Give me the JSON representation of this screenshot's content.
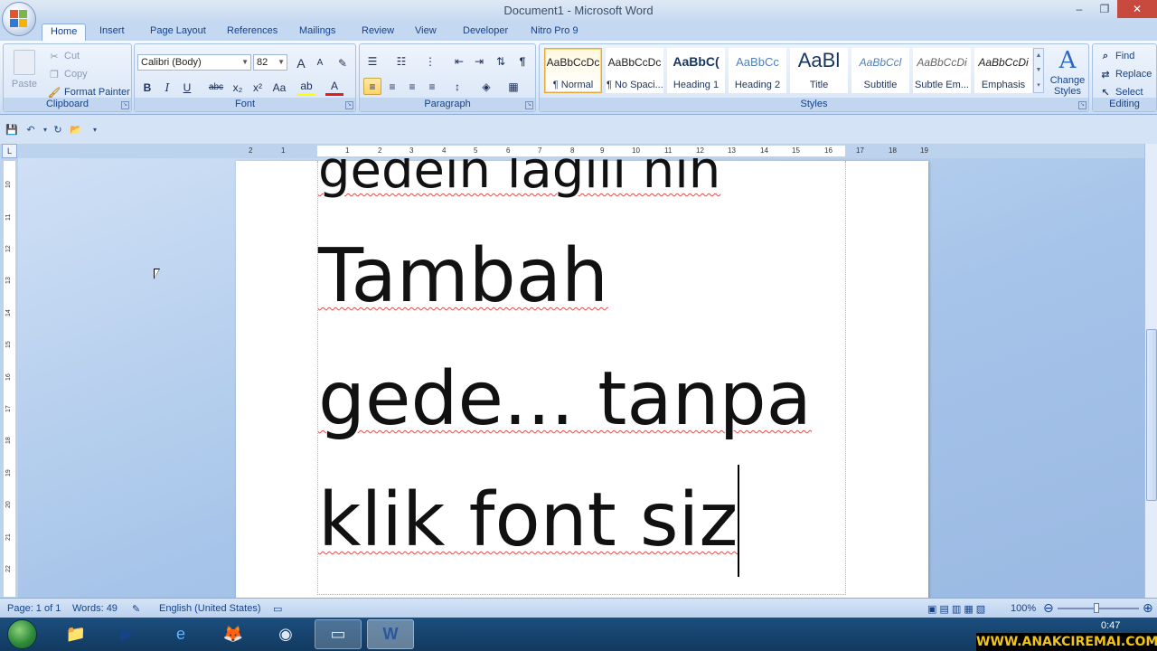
{
  "window": {
    "title": "Document1 - Microsoft Word",
    "minimize": "–",
    "restore": "❐",
    "close": "✕"
  },
  "tabs": [
    "Home",
    "Insert",
    "Page Layout",
    "References",
    "Mailings",
    "Review",
    "View",
    "Developer",
    "Nitro Pro 9"
  ],
  "clipboard": {
    "paste": "Paste",
    "cut": "Cut",
    "copy": "Copy",
    "format_painter": "Format Painter",
    "label": "Clipboard"
  },
  "font": {
    "name": "Calibri (Body)",
    "size": "82",
    "label": "Font",
    "grow": "A",
    "shrink": "A",
    "clear": "✎",
    "bold": "B",
    "italic": "I",
    "underline": "U",
    "strike": "abc",
    "subscript": "x₂",
    "superscript": "x²",
    "case": "Aa",
    "highlight": "ab",
    "color": "A"
  },
  "paragraph": {
    "label": "Paragraph",
    "bullets": "☰",
    "numbering": "☷",
    "multilevel": "⋮",
    "decrease_indent": "⇤",
    "increase_indent": "⇥",
    "sort": "⇅",
    "show_marks": "¶",
    "align_left": "≡",
    "align_center": "≡",
    "align_right": "≡",
    "justify": "≡",
    "line_spacing": "↕",
    "shading": "◈",
    "borders": "▦"
  },
  "styles": {
    "label": "Styles",
    "items": [
      {
        "preview": "AaBbCcDc",
        "name": "¶ Normal"
      },
      {
        "preview": "AaBbCcDc",
        "name": "¶ No Spaci..."
      },
      {
        "preview": "AaBbC(",
        "name": "Heading 1"
      },
      {
        "preview": "AaBbCc",
        "name": "Heading 2"
      },
      {
        "preview": "AaBl",
        "name": "Title"
      },
      {
        "preview": "AaBbCcl",
        "name": "Subtitle"
      },
      {
        "preview": "AaBbCcDi",
        "name": "Subtle Em..."
      },
      {
        "preview": "AaBbCcDi",
        "name": "Emphasis"
      }
    ],
    "change_styles": "Change Styles",
    "change_icon": "A"
  },
  "editing": {
    "label": "Editing",
    "find": "Find",
    "replace": "Replace",
    "select": "Select"
  },
  "ruler": {
    "corner": "L",
    "hticks": [
      "2",
      "1",
      "1",
      "2",
      "3",
      "4",
      "5",
      "6",
      "7",
      "8",
      "9",
      "10",
      "11",
      "12",
      "13",
      "14",
      "15",
      "16",
      "17",
      "18",
      "19"
    ],
    "vticks": [
      "10",
      "11",
      "12",
      "13",
      "14",
      "15",
      "16",
      "17",
      "18",
      "19",
      "20",
      "21",
      "22"
    ]
  },
  "document": {
    "lines": [
      "gedein lagiii nih",
      "Tambah",
      "gede... tanpa",
      "klik font siz"
    ]
  },
  "status": {
    "page": "Page: 1 of 1",
    "words": "Words: 49",
    "language": "English (United States)",
    "zoom": "100%"
  },
  "taskbar": {
    "clock": "0:47",
    "watermark": "WWW.ANAKCIREMAI.COM"
  }
}
